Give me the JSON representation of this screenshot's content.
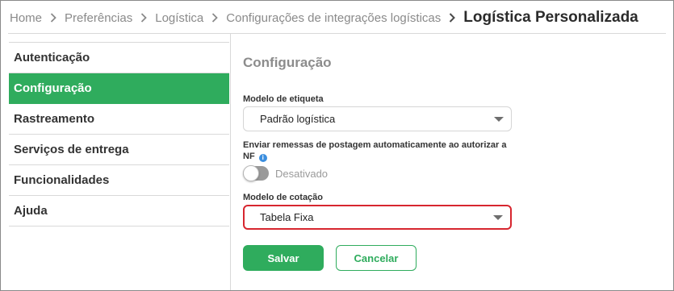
{
  "breadcrumb": {
    "items": [
      "Home",
      "Preferências",
      "Logística",
      "Configurações de integrações logísticas"
    ],
    "current": "Logística Personalizada"
  },
  "sidebar": {
    "items": [
      {
        "label": "Autenticação",
        "active": false
      },
      {
        "label": "Configuração",
        "active": true
      },
      {
        "label": "Rastreamento",
        "active": false
      },
      {
        "label": "Serviços de entrega",
        "active": false
      },
      {
        "label": "Funcionalidades",
        "active": false
      },
      {
        "label": "Ajuda",
        "active": false
      }
    ]
  },
  "main": {
    "title": "Configuração",
    "label_modelo_etiqueta": "Modelo de etiqueta",
    "select_modelo_etiqueta": "Padrão logística",
    "label_enviar_remessas": "Enviar remessas de postagem automaticamente ao autorizar a NF",
    "info_icon_glyph": "i",
    "toggle_label": "Desativado",
    "toggle_on": false,
    "label_modelo_cotacao": "Modelo de cotação",
    "select_modelo_cotacao": "Tabela Fixa",
    "save_label": "Salvar",
    "cancel_label": "Cancelar"
  },
  "colors": {
    "accent": "#2fac5d",
    "highlight_border": "#d7262f",
    "info": "#3b8ede"
  }
}
